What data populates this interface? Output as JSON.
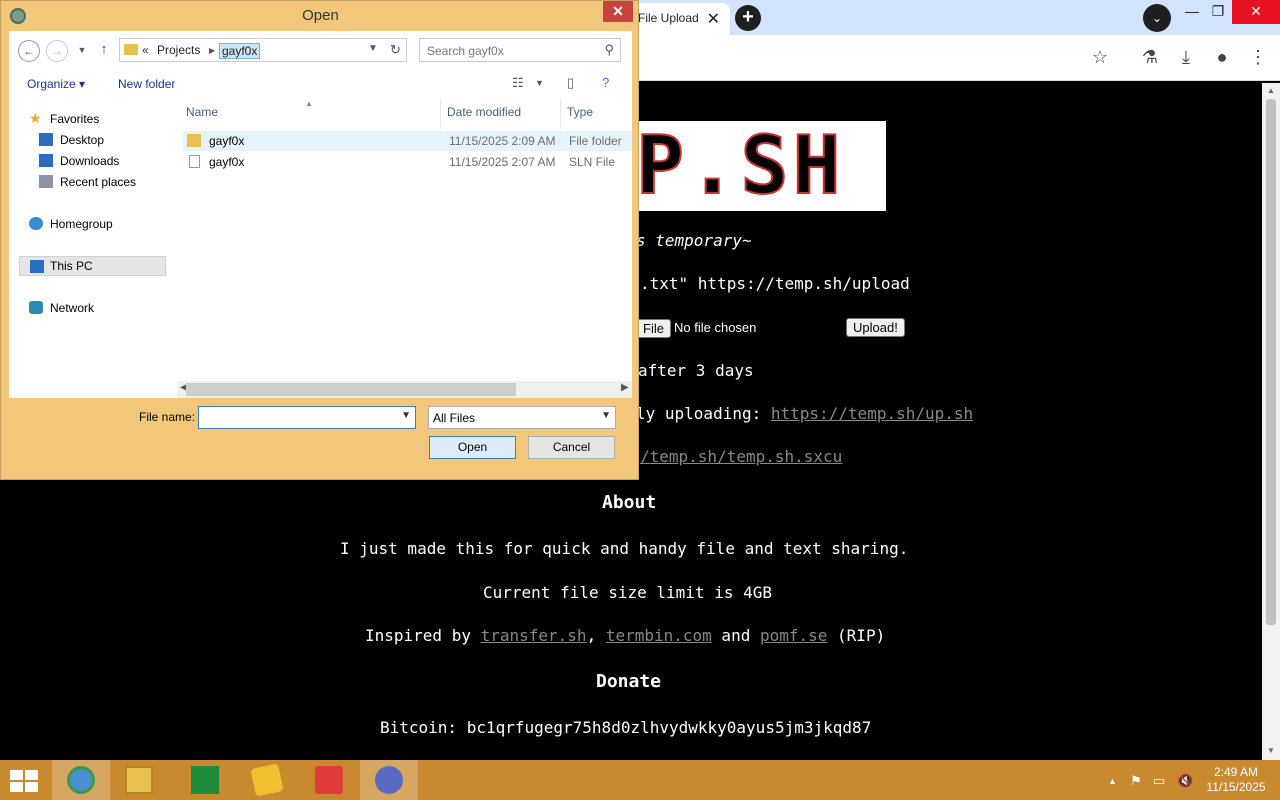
{
  "dialog": {
    "title": "Open",
    "address": {
      "overflow": "«",
      "parent": "Projects",
      "current": "gayf0x"
    },
    "search_placeholder": "Search gayf0x",
    "organize_label": "Organize",
    "new_folder_label": "New folder",
    "sidebar": {
      "favorites": "Favorites",
      "desktop": "Desktop",
      "downloads": "Downloads",
      "recent": "Recent places",
      "homegroup": "Homegroup",
      "this_pc": "This PC",
      "network": "Network"
    },
    "columns": {
      "name": "Name",
      "date": "Date modified",
      "type": "Type"
    },
    "files": [
      {
        "name": "gayf0x",
        "date": "11/15/2025 2:09 AM",
        "type": "File folder",
        "icon": "folder-icon"
      },
      {
        "name": "gayf0x",
        "date": "11/15/2025 2:07 AM",
        "type": "SLN File",
        "icon": "sln-file-icon"
      }
    ],
    "file_name_label": "File name:",
    "file_name_value": "",
    "file_type_value": "All Files",
    "open_button": "Open",
    "cancel_button": "Cancel"
  },
  "browser": {
    "tab_title": "File Upload",
    "new_tab": "+",
    "page": {
      "logo_text": "P.SH",
      "tagline": "s temporary~",
      "curl_line": ".txt\" https://temp.sh/upload",
      "file_button": "File",
      "no_file": "No file chosen",
      "upload_button": "Upload!",
      "expiry": "after 3 days",
      "script_prefix": "ly uploading: ",
      "script_link": "https://temp.sh/up.sh",
      "sharex_link": "/temp.sh/temp.sh.sxcu",
      "about_heading": "About",
      "about_text": "I just made this for quick and handy file and text sharing.",
      "size_limit": "Current file size limit is 4GB",
      "inspired_prefix": "Inspired by ",
      "inspired_link1": "transfer.sh",
      "inspired_sep": ", ",
      "inspired_link2": "termbin.com",
      "inspired_and": " and ",
      "inspired_link3": "pomf.se",
      "inspired_suffix": " (RIP)",
      "donate_heading": "Donate",
      "bitcoin": "Bitcoin: bc1qrfugegr75h8d0zlhvydwkky0ayus5jm3jkqd87"
    }
  },
  "taskbar": {
    "clock_time": "2:49 AM",
    "clock_date": "11/15/2025"
  },
  "colors": {
    "dialog_frame": "#f2c77a",
    "taskbar": "#c9892e",
    "close_red": "#c7433b",
    "link_gray": "#888888"
  }
}
